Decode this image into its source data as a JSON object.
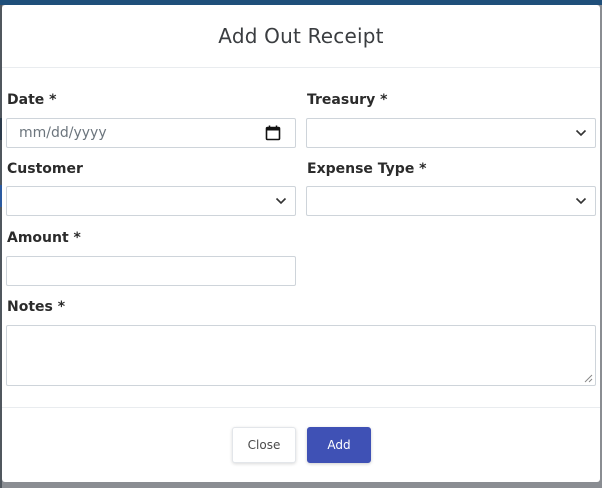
{
  "modal": {
    "title": "Add Out Receipt",
    "fields": {
      "date": {
        "label": "Date *",
        "placeholder": "mm/dd/yyyy",
        "icon": "calendar-icon"
      },
      "treasury": {
        "label": "Treasury *",
        "value": "",
        "icon": "chevron-down-icon"
      },
      "customer": {
        "label": "Customer",
        "value": "",
        "icon": "chevron-down-icon"
      },
      "expense_type": {
        "label": "Expense Type *",
        "value": "",
        "icon": "chevron-down-icon"
      },
      "amount": {
        "label": "Amount *",
        "value": ""
      },
      "notes": {
        "label": "Notes *",
        "value": ""
      }
    },
    "buttons": {
      "close": "Close",
      "add": "Add"
    }
  },
  "colors": {
    "accent": "#3f51b5",
    "topbar": "#1f4f7a",
    "backdrop": "#8a8d92"
  }
}
